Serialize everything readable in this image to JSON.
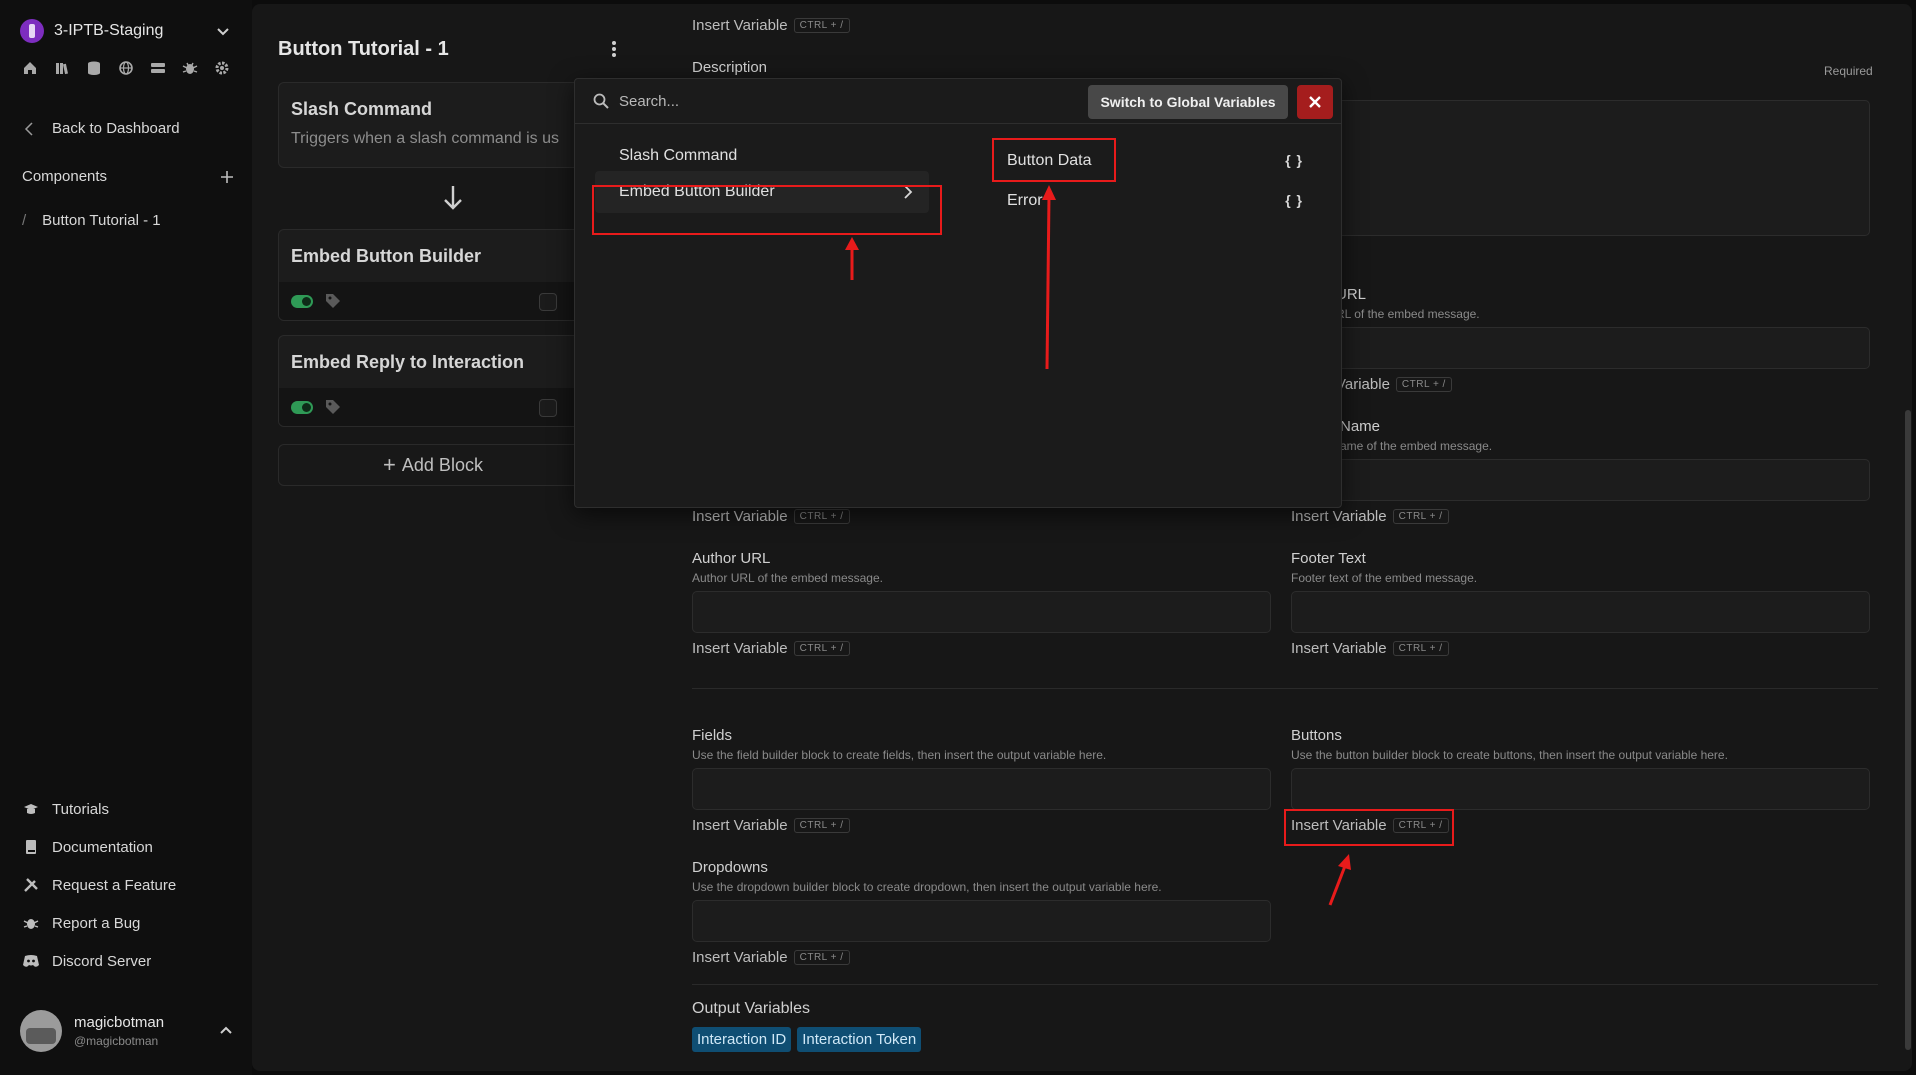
{
  "workspace": {
    "name": "3-IPTB-Staging"
  },
  "nav": {
    "back": "Back to Dashboard",
    "components_header": "Components",
    "components": [
      "Button Tutorial - 1"
    ],
    "links": [
      "Tutorials",
      "Documentation",
      "Request a Feature",
      "Report a Bug",
      "Discord Server"
    ]
  },
  "user": {
    "name": "magicbotman",
    "handle": "@magicbotman"
  },
  "flow": {
    "title": "Button Tutorial - 1",
    "blocks": [
      {
        "title": "Slash Command",
        "desc": "Triggers when a slash command is us"
      },
      {
        "title": "Embed Button Builder"
      },
      {
        "title": "Embed Reply to Interaction"
      }
    ],
    "add_block": "Add Block"
  },
  "form": {
    "insert_variable": "Insert Variable",
    "shortcut": "CTRL + /",
    "required": "Required",
    "description_label": "Description",
    "url_label": "URL",
    "url_hint": "RL of the embed message.",
    "name_label": "Name",
    "name_hint": "ame of the embed message.",
    "variable_partial": "Variable",
    "author_url_label": "Author URL",
    "author_url_hint": "Author URL of the embed message.",
    "footer_text_label": "Footer Text",
    "footer_text_hint": "Footer text of the embed message.",
    "fields_label": "Fields",
    "fields_hint": "Use the field builder block to create fields, then insert the output variable here.",
    "buttons_label": "Buttons",
    "buttons_hint": "Use the button builder block to create buttons, then insert the output variable here.",
    "dropdowns_label": "Dropdowns",
    "dropdowns_hint": "Use the dropdown builder block to create dropdown, then insert the output variable here.",
    "output_title": "Output Variables",
    "outputs": [
      "Interaction ID",
      "Interaction Token"
    ]
  },
  "popup": {
    "search_placeholder": "Search...",
    "switch_label": "Switch to Global Variables",
    "categories": [
      "Slash Command",
      "Embed Button Builder"
    ],
    "variables": [
      {
        "name": "Button Data",
        "type_glyph": "{ }"
      },
      {
        "name": "Error",
        "type_glyph": "{ }"
      }
    ]
  },
  "colors": {
    "accent_red": "#e81b1b",
    "close_button": "#a51d1d",
    "chip_blue": "#0f4e73",
    "toggle_green": "#2f9a56"
  }
}
